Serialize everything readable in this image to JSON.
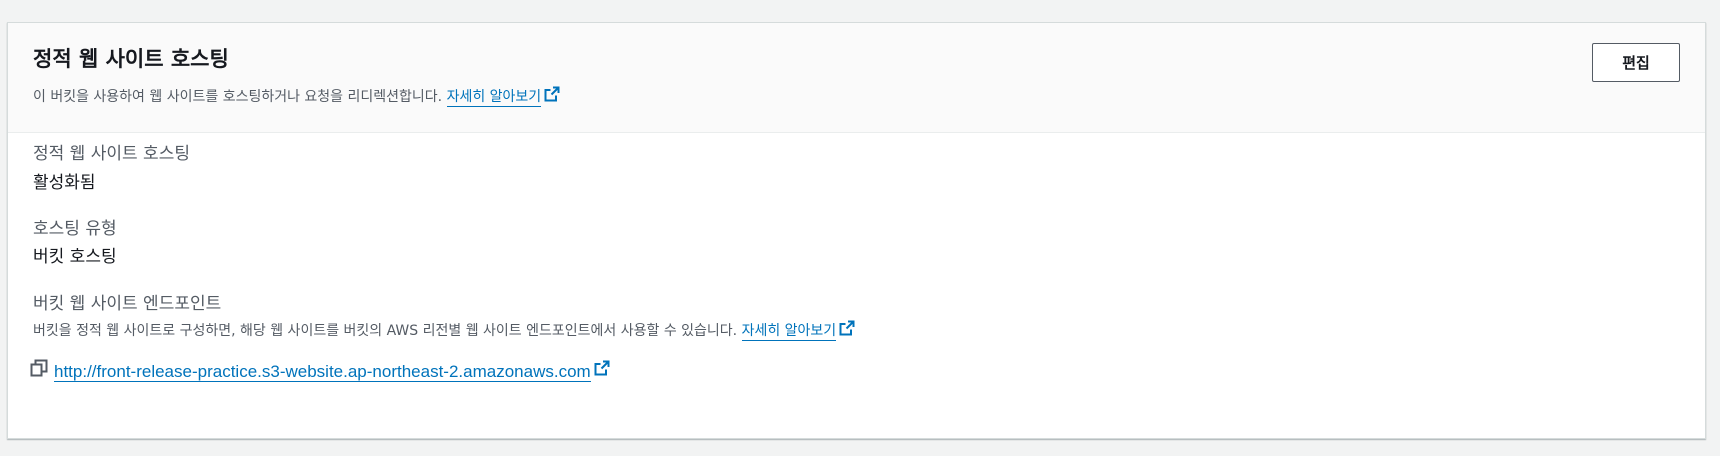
{
  "panel": {
    "title": "정적 웹 사이트 호스팅",
    "description": "이 버킷을 사용하여 웹 사이트를 호스팅하거나 요청을 리디렉션합니다.",
    "learn_more": "자세히 알아보기",
    "edit_button": "편집"
  },
  "fields": {
    "hosting_label": "정적 웹 사이트 호스팅",
    "hosting_value": "활성화됨",
    "type_label": "호스팅 유형",
    "type_value": "버킷 호스팅",
    "endpoint_label": "버킷 웹 사이트 엔드포인트",
    "endpoint_description": "버킷을 정적 웹 사이트로 구성하면, 해당 웹 사이트를 버킷의 AWS 리전별 웹 사이트 엔드포인트에서 사용할 수 있습니다.",
    "endpoint_learn_more": "자세히 알아보기",
    "endpoint_url": "http://front-release-practice.s3-website.ap-northeast-2.amazonaws.com"
  },
  "icons": {
    "external": "external-link-icon",
    "copy": "copy-icon"
  },
  "colors": {
    "link": "#0073bb",
    "background": "#f2f3f3",
    "header_bg": "#fafafa",
    "text": "#16191f",
    "muted": "#545b64"
  }
}
